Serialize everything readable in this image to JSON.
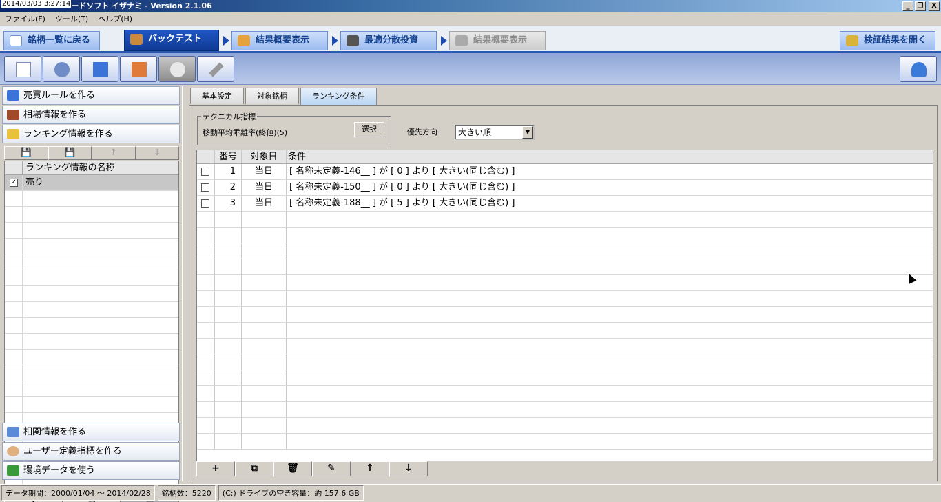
{
  "window": {
    "timestamp": "2014/03/03 3:27:14",
    "title": "ードソフト イザナミ - Version 2.1.06",
    "min": "_",
    "restore": "❐",
    "close": "X"
  },
  "menu": [
    "ファイル(F)",
    "ツール(T)",
    "ヘルプ(H)"
  ],
  "steps": {
    "back": "銘柄一覧に戻る",
    "backtest": "バックテスト",
    "summary": "結果概要表示",
    "optimal": "最適分散投資",
    "summary2": "結果概要表示",
    "open": "検証結果を開く"
  },
  "left": {
    "sections": {
      "rule": "売買ルールを作る",
      "market": "相場情報を作る",
      "ranking": "ランキング情報を作る",
      "correlation": "相関情報を作る",
      "user": "ユーザー定義指標を作る",
      "env": "環境データを使う"
    },
    "grid_header": "ランキング情報の名称",
    "rows": [
      {
        "checked": "✓",
        "name": "売り"
      }
    ],
    "tools": [
      "💾",
      "💾",
      "↑",
      "↓"
    ],
    "bottom_tools": [
      "+",
      "⧉",
      "🗑"
    ]
  },
  "tabs": [
    "基本設定",
    "対象銘柄",
    "ランキング条件"
  ],
  "technical": {
    "legend": "テクニカル指標",
    "value": "移動平均乖離率(終値)(5)",
    "select_button": "選択",
    "priority_label": "優先方向",
    "priority_value": "大きい順",
    "dropdown": "▼"
  },
  "conditions": {
    "headers": {
      "no": "番号",
      "day": "対象日",
      "cond": "条件"
    },
    "rows": [
      {
        "no": "1",
        "day": "当日",
        "cond": "[ 名称未定義-146__ ] が [ 0 ] より [ 大きい(同じ含む) ]"
      },
      {
        "no": "2",
        "day": "当日",
        "cond": "[ 名称未定義-150__ ] が [ 0 ] より [ 大きい(同じ含む) ]"
      },
      {
        "no": "3",
        "day": "当日",
        "cond": "[ 名称未定義-188__ ] が [ 5 ] より [ 大きい(同じ含む) ]"
      }
    ],
    "tools": [
      "+",
      "⧉",
      "🗑",
      "✎",
      "↑",
      "↓"
    ]
  },
  "status": {
    "period": "データ期間：2000/01/04 〜 2014/02/28",
    "count": "銘柄数：5220",
    "disk": "(C:) ドライブの空き容量：約 157.6 GB"
  }
}
